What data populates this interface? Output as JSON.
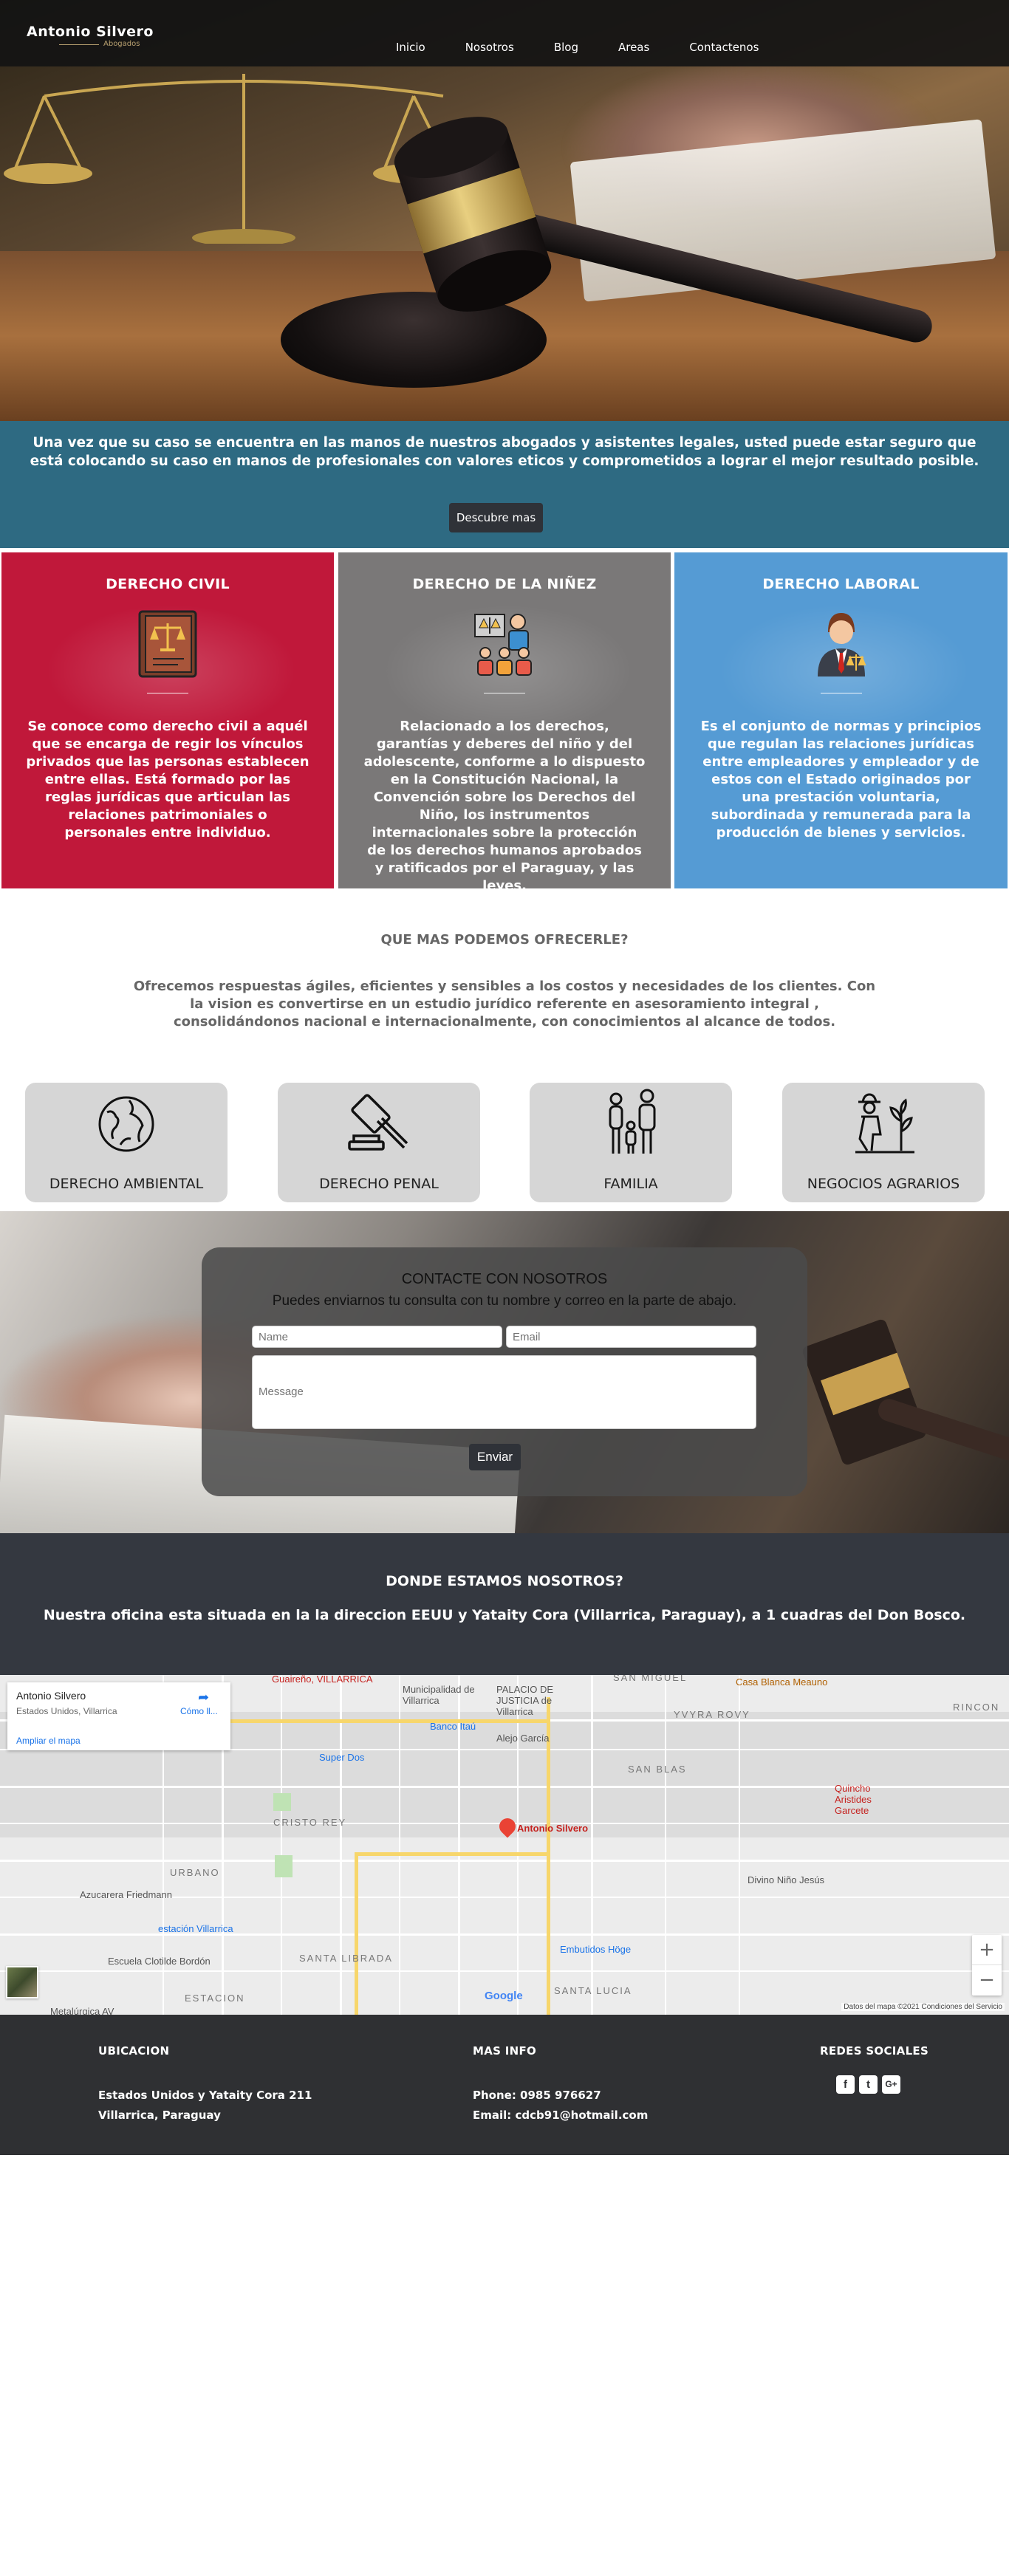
{
  "brand": {
    "name": "Antonio Silvero",
    "subtitle": "Abogados"
  },
  "nav": {
    "items": [
      "Inicio",
      "Nosotros",
      "Blog",
      "Areas",
      "Contactenos"
    ]
  },
  "hero": {
    "text": "Una vez que su caso se encuentra en las manos de nuestros abogados y asistentes legales, usted puede estar seguro que está colocando su caso en manos de profesionales con valores eticos y comprometidos a lograr el mejor resultado posible.",
    "button": "Descubre mas"
  },
  "areas": [
    {
      "title": "DERECHO CIVIL",
      "icon": "law-book-icon",
      "text": "Se conoce como derecho civil a aquél que se encarga de regir los vínculos privados que las personas establecen entre ellas. Está formado por las reglas jurídicas que articulan las relaciones patrimoniales o personales entre individuo."
    },
    {
      "title": "DERECHO DE LA NIÑEZ",
      "icon": "family-court-icon",
      "text": "Relacionado a los derechos, garantías y deberes del niño y del adolescente, conforme a lo dispuesto en la Constitución Nacional, la Convención sobre los Derechos del Niño, los instrumentos internacionales sobre la protección de los derechos humanos aprobados y ratificados por el Paraguay, y las leyes."
    },
    {
      "title": "DERECHO LABORAL",
      "icon": "lawyer-icon",
      "text": "Es el conjunto de normas y principios que regulan las relaciones jurídicas entre empleadores y empleador y de estos con el Estado originados por una prestación voluntaria, subordinada y remunerada para la producción de bienes y servicios."
    }
  ],
  "offer": {
    "title": "QUE MAS PODEMOS OFRECERLE?",
    "text": "Ofrecemos respuestas ágiles, eficientes y sensibles a los costos y necesidades de los clientes. Con la vision es convertirse en un estudio jurídico referente en asesoramiento integral , consolidándonos nacional e internacionalmente, con conocimientos al alcance de todos."
  },
  "services": [
    {
      "label": "DERECHO AMBIENTAL",
      "icon": "globe-icon"
    },
    {
      "label": "DERECHO PENAL",
      "icon": "gavel-icon"
    },
    {
      "label": "FAMILIA",
      "icon": "family-icon"
    },
    {
      "label": "NEGOCIOS AGRARIOS",
      "icon": "farmer-icon"
    }
  ],
  "contact": {
    "title": "CONTACTE CON NOSOTROS",
    "lead": "Puedes enviarnos tu consulta con tu nombre y correo en la parte de abajo.",
    "name_placeholder": "Name",
    "email_placeholder": "Email",
    "message_placeholder": "Message",
    "send": "Enviar"
  },
  "location": {
    "title": "DONDE ESTAMOS NOSOTROS?",
    "text": "Nuestra oficina esta situada en la la direccion EEUU y Yataity Cora (Villarrica, Paraguay), a 1 cuadras del Don Bosco."
  },
  "map": {
    "place": "Antonio Silvero",
    "place_sub": "Estados Unidos, Villarrica",
    "directions": "Cómo ll...",
    "enlarge": "Ampliar el mapa",
    "marker": "Antonio Silvero",
    "neighborhoods": [
      "SAN MIGUEL",
      "YVYRA ROVY",
      "RINCON",
      "SAN BLAS",
      "CRISTO REY",
      "URBANO",
      "SANTA LIBRADA",
      "SANTA LUCIA",
      "ESTACION"
    ],
    "pois": [
      "Guaireño, VILLARRICA",
      "Municipalidad de Villarrica",
      "PALACIO DE JUSTICIA de Villarrica",
      "Banco Itaú",
      "Alejo García",
      "Super Dos",
      "Casa Blanca Meauno",
      "Quincho Aristides Garcete",
      "Divino Niño Jesús",
      "Azucarera Friedmann",
      "estación Villarrica",
      "Escuela Clotilde Bordón",
      "Embutidos Höge",
      "Metalúrgica AV"
    ],
    "google": "Google",
    "attribution": "Datos del mapa ©2021   Condiciones del Servicio"
  },
  "footer": {
    "ubicacion": {
      "title": "UBICACION",
      "lines": [
        "Estados Unidos y Yataity Cora 211",
        "Villarrica, Paraguay"
      ]
    },
    "info": {
      "title": "MAS INFO",
      "lines": [
        "Phone: 0985 976627",
        "Email: cdcb91@hotmail.com"
      ]
    },
    "social": {
      "title": "REDES SOCIALES",
      "icons": [
        "facebook-icon",
        "twitter-icon",
        "google-plus-icon"
      ]
    }
  }
}
